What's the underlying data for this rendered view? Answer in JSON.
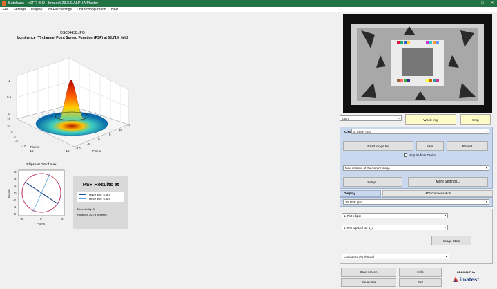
{
  "window": {
    "title": "Batchans - eSFR ISO - Imatest 23.2.0.ALPHA Master",
    "controls": [
      "–",
      "□",
      "✕"
    ]
  },
  "menu": [
    "File",
    "Settings",
    "Display",
    "INI File Settings",
    "Chart configuration",
    "Help"
  ],
  "plot3d": {
    "filename": "DSC04438.JPG",
    "title": "Luminence (Y) channel Point Spread Function (PSF) at 68.71% field",
    "z_ticks": [
      "1",
      "0.5",
      "0",
      "15",
      "10"
    ],
    "x_ticks": [
      "-15",
      "-10",
      "-5",
      "0",
      "5",
      "10",
      "15"
    ],
    "y_ticks": [
      "5",
      "0",
      "-5",
      "-10",
      "-15"
    ],
    "xlabel": "Pixels",
    "ylabel": "Pixels"
  },
  "ellipse": {
    "title": "Ellipse at 0.5 of max",
    "y_ticks": [
      "6",
      "4",
      "2",
      "0",
      "-2",
      "-4",
      "-6"
    ],
    "x_ticks": [
      "-5",
      "0",
      "5"
    ],
    "xlabel": "Pixels",
    "ylabel": "Pixels"
  },
  "results": {
    "title": "PSF Results at",
    "major_label": "Major axis: 5.463",
    "minor_label": "Minor axis: 5.463",
    "eccentricity": "Eccentricity: 0",
    "rotation": "Rotation: 26.73 degrees"
  },
  "image_controls": {
    "zoom_value": "Zoom",
    "whole_img": "Whole img",
    "crop": "Crop"
  },
  "chart_panel": {
    "chart_label": "Chart",
    "chart_value": "S: eSFR ISO",
    "read_image": "Read image file",
    "save": "Save",
    "reload": "Reload",
    "acquire_label": "Acquire from Device",
    "analysis_value": "New analysis of the current image",
    "setup": "Setup...",
    "more_settings": "More Settings..."
  },
  "display_panel": {
    "tab_display": "Display",
    "tab_mtf": "MTF compensation",
    "plot_value": "18. PSF plot",
    "ellipse_value": "1. Plot ellipse",
    "region_value": "1 69% top-L of ctr. 1_3",
    "image_stats": "Image Stats",
    "channel_value": "Luminance (Y) channel"
  },
  "bottom": {
    "save_screen": "Save screen",
    "help": "Help",
    "save_data": "Save data",
    "exit": "Exit",
    "version": "23.2.0.ALPHA",
    "brand": "imatest"
  },
  "colors": {
    "titlebar": "#217346",
    "panel_bg": "#c9d8ef",
    "yellow_btn": "#fffbc6"
  }
}
